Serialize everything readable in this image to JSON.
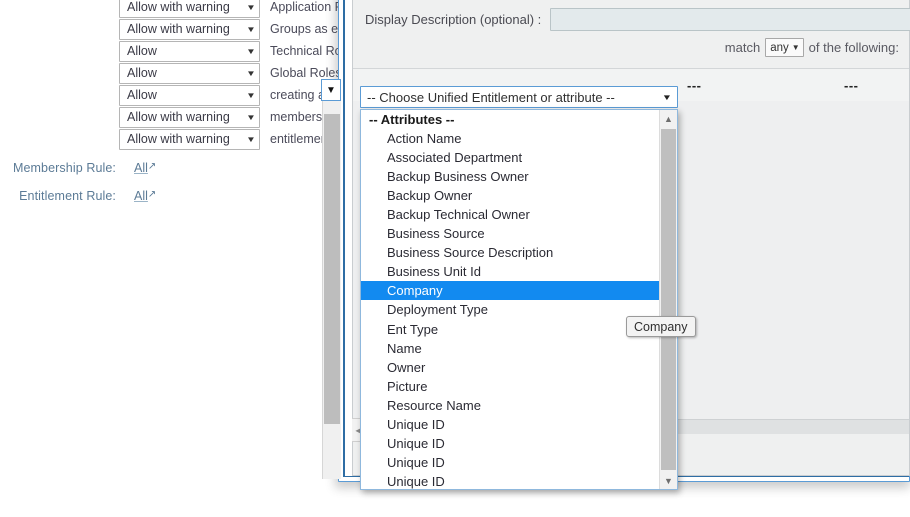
{
  "background": {
    "permission_rows": [
      {
        "value": "Allow with warning",
        "description": "Application R"
      },
      {
        "value": "Allow with warning",
        "description": "Groups as en"
      },
      {
        "value": "Allow",
        "description": "Technical Rol"
      },
      {
        "value": "Allow",
        "description": "Global Roles"
      },
      {
        "value": "Allow",
        "description": "creating a hie"
      },
      {
        "value": "Allow with warning",
        "description": "members no"
      },
      {
        "value": "Allow with warning",
        "description": "entitlements"
      }
    ],
    "rules": [
      {
        "label": "Membership Rule:",
        "link": "All"
      },
      {
        "label": "Entitlement Rule:",
        "link": "All"
      }
    ],
    "select_caret": "▼",
    "external_link_icon": "↗"
  },
  "modal": {
    "description_label": "Display Description (optional) :",
    "description_value": "",
    "description_placeholder": "",
    "match_prefix": "match",
    "match_value": "any",
    "match_suffix": "of the following:",
    "caret_icon": "▼",
    "column_placeholders": [
      "---",
      "---"
    ],
    "collapse_icon": "◀",
    "scroll_up_icon": "▲",
    "scroll_down_icon": "▼",
    "filter_icon": "▼"
  },
  "dropdown": {
    "selected_label": "-- Choose Unified Entitlement or attribute --",
    "caret_icon": "▼",
    "scroll_up_icon": "▲",
    "scroll_down_icon": "▼",
    "highlighted": "Company",
    "options": [
      {
        "label": "-- Attributes --",
        "group": true
      },
      {
        "label": "Action Name"
      },
      {
        "label": "Associated Department"
      },
      {
        "label": "Backup Business Owner"
      },
      {
        "label": "Backup Owner"
      },
      {
        "label": "Backup Technical Owner"
      },
      {
        "label": "Business Source"
      },
      {
        "label": "Business Source Description"
      },
      {
        "label": "Business Unit Id"
      },
      {
        "label": "Company",
        "selected": true
      },
      {
        "label": "Deployment Type"
      },
      {
        "label": "Ent Type"
      },
      {
        "label": "Name"
      },
      {
        "label": "Owner"
      },
      {
        "label": "Picture"
      },
      {
        "label": "Resource Name"
      },
      {
        "label": "Unique ID"
      },
      {
        "label": "Unique ID"
      },
      {
        "label": "Unique ID"
      },
      {
        "label": "Unique ID"
      }
    ]
  },
  "tooltip": {
    "text": "Company"
  },
  "colors": {
    "selection_blue": "#128af0",
    "modal_border_blue": "#5b9bd5",
    "label_blue_gray": "#5c7b96",
    "input_background": "#e3eaec"
  }
}
